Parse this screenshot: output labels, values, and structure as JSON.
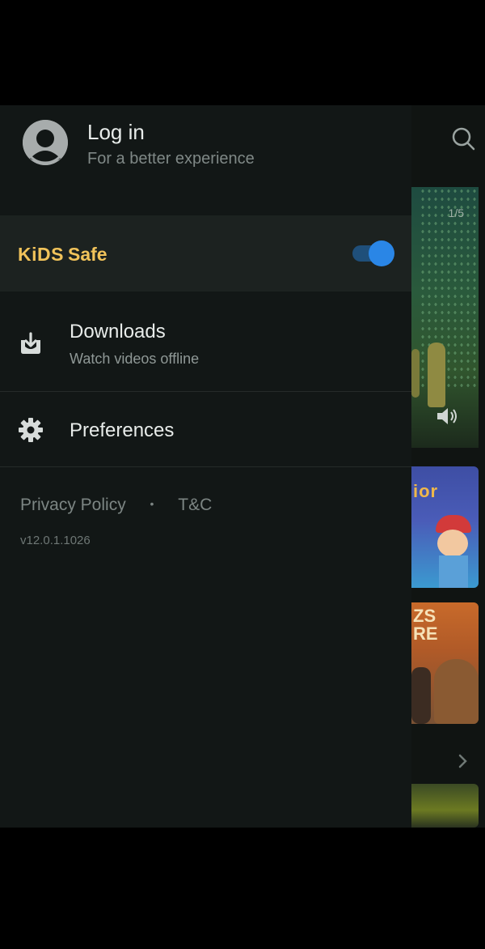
{
  "drawer": {
    "login": {
      "title": "Log in",
      "subtitle": "For a better experience",
      "icon": "user-avatar-icon"
    },
    "kids_safe": {
      "logo": "KiDS",
      "label": "Safe",
      "enabled": true,
      "accent_color": "#f1c35a",
      "toggle_color": "#2a86e6"
    },
    "items": [
      {
        "title": "Downloads",
        "subtitle": "Watch videos offline",
        "icon": "download-icon"
      },
      {
        "title": "Preferences",
        "icon": "gear-icon"
      }
    ],
    "footer": {
      "privacy": "Privacy Policy",
      "separator": "•",
      "terms": "T&C",
      "version": "v12.0.1.1026"
    }
  },
  "background_app": {
    "search_icon": "search-icon",
    "banner_counter": "1/5",
    "volume_icon": "volume-icon",
    "thumb1_title": "ior",
    "thumb2_title": "ZS\nRE",
    "chevron_icon": "chevron-right-icon"
  }
}
